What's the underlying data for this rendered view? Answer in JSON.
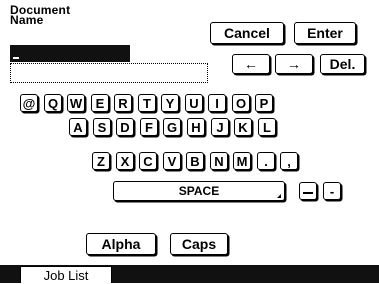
{
  "header": {
    "title": "Document\nName",
    "cancel_label": "Cancel",
    "enter_label": "Enter"
  },
  "entry": {
    "value": ""
  },
  "editing": {
    "left_arrow": "←",
    "right_arrow": "→",
    "delete_label": "Del."
  },
  "keyboard": {
    "row1": [
      "@",
      "Q",
      "W",
      "E",
      "R",
      "T",
      "Y",
      "U",
      "I",
      "O",
      "P"
    ],
    "row2": [
      "A",
      "S",
      "D",
      "F",
      "G",
      "H",
      "J",
      "K",
      "L"
    ],
    "row3": [
      "Z",
      "X",
      "C",
      "V",
      "B",
      "N",
      "M",
      ".",
      ","
    ],
    "space_label": "SPACE",
    "underscore_label": "_",
    "hyphen_label": "-"
  },
  "modes": {
    "alpha_label": "Alpha",
    "caps_label": "Caps"
  },
  "footer": {
    "tab_label": "Job List"
  }
}
